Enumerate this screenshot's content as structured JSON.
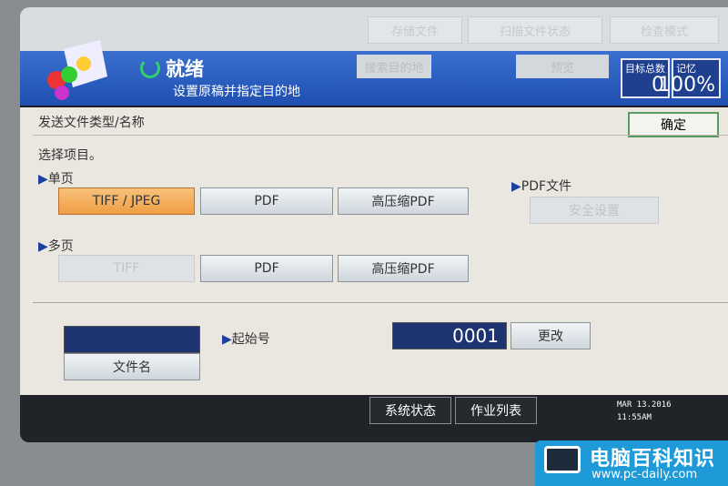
{
  "top_buttons": [
    "存储文件",
    "扫描文件状态",
    "检查模式"
  ],
  "header": {
    "status": "就绪",
    "subtitle": "设置原稿并指定目的地",
    "search_dest": "搜索目的地",
    "preview": "预览",
    "total_dest_label": "目标总数",
    "total_dest_value": "0",
    "memory_label": "记忆",
    "memory_value": "100%"
  },
  "panel": {
    "title": "发送文件类型/名称",
    "ok": "确定",
    "instruction": "选择项目。",
    "single_page": "单页",
    "single_options": [
      "TIFF / JPEG",
      "PDF",
      "高压缩PDF"
    ],
    "multi_page": "多页",
    "multi_options": [
      "TIFF",
      "PDF",
      "高压缩PDF"
    ],
    "pdf_file": "PDF文件",
    "security": "安全设置",
    "file_name_value": "",
    "file_name_button": "文件名",
    "start_no_label": "起始号",
    "start_no_value": "0001",
    "change": "更改"
  },
  "bottom": {
    "system_status": "系统状态",
    "job_list": "作业列表",
    "date": "MAR  13.2016",
    "time": "11:55AM"
  },
  "watermark": {
    "title": "电脑百科知识",
    "url": "www.pc-daily.com"
  },
  "colors": {
    "selected": "#ef9e45",
    "header": "#1f4fb0"
  }
}
